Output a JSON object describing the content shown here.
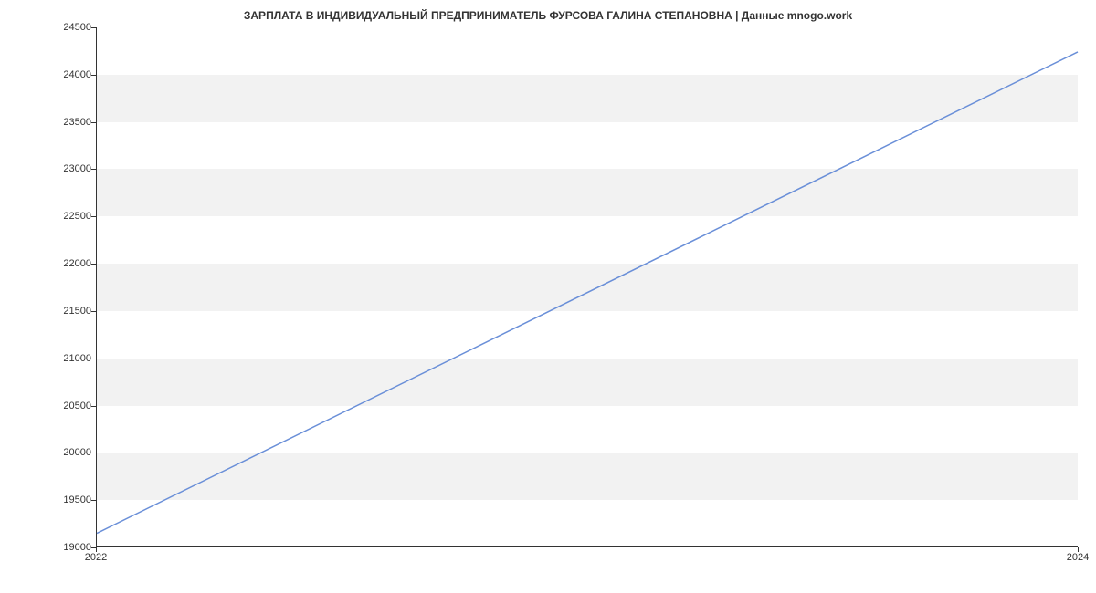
{
  "chart_data": {
    "type": "line",
    "title": "ЗАРПЛАТА В ИНДИВИДУАЛЬНЫЙ ПРЕДПРИНИМАТЕЛЬ  ФУРСОВА ГАЛИНА СТЕПАНОВНА | Данные mnogo.work",
    "x": [
      2022,
      2024
    ],
    "values": [
      19140,
      24240
    ],
    "xlabel": "",
    "ylabel": "",
    "x_ticks": [
      2022,
      2024
    ],
    "y_ticks": [
      19000,
      19500,
      20000,
      20500,
      21000,
      21500,
      22000,
      22500,
      23000,
      23500,
      24000,
      24500
    ],
    "xlim": [
      2022,
      2024
    ],
    "ylim": [
      19000,
      24500
    ],
    "line_color": "#6a8fd8",
    "grid_bands": true
  }
}
